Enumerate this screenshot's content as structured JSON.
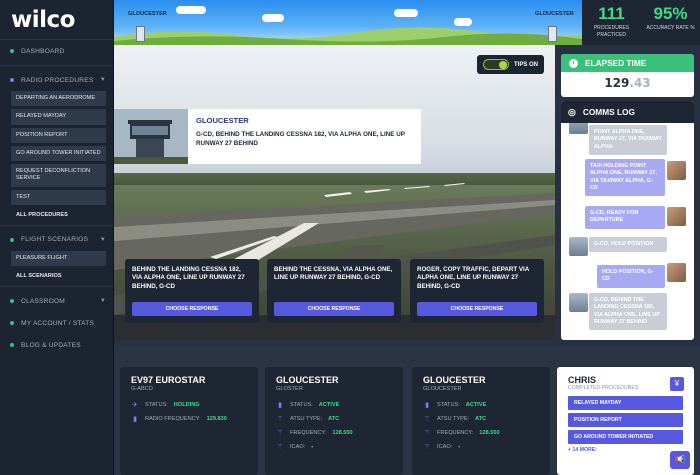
{
  "app": {
    "logo": "wilco"
  },
  "sidebar": {
    "dashboard": "Dashboard",
    "radio_procedures": "Radio Procedures",
    "radio_items": [
      "Departing an Aerodrome",
      "Relayed Mayday",
      "Position Report",
      "Go Around Tower Initiated",
      "Request Deconfliction Service",
      "Test"
    ],
    "all_procedures": "All Procedures",
    "flight_scenarios": "Flight Scenarios",
    "scenario_items": [
      "Pleasure Flight"
    ],
    "all_scenarios": "All Scenarios",
    "classroom": "Classroom",
    "my_account": "My Account / Stats",
    "blog": "Blog & Updates"
  },
  "topbar": {
    "origin": "Gloucester",
    "destination": "Gloucester"
  },
  "stats": {
    "procedures_value": "111",
    "procedures_label": "Procedures Practiced",
    "accuracy_value": "95%",
    "accuracy_label": "Accuracy Rate %"
  },
  "tips": {
    "label": "Tips On"
  },
  "atc": {
    "name": "Gloucester",
    "message": "G-CD, behind the landing Cessna 182, via Alpha One, line up runway 27 behind"
  },
  "responses": [
    {
      "text": "Behind the landing Cessna 182, via Alpha One, line up runway 27 behind, G-CD",
      "button": "Choose Response"
    },
    {
      "text": "Behind the Cessna, via Alpha One, line up runway 27 behind, G-CD",
      "button": "Choose Response"
    },
    {
      "text": "Roger, copy traffic, depart via Alpha One, line up runway 27 behind, G-CD",
      "button": "Choose Response"
    }
  ],
  "elapsed": {
    "label": "Elapsed Time",
    "main": "129",
    "fraction": ".43"
  },
  "comms": {
    "label": "Comms Log",
    "messages": [
      {
        "side": "left",
        "text": "Point Alpha One, runway 27, via taxiway Alpha"
      },
      {
        "side": "right",
        "text": "Taxi holding point Alpha One, runway 27, via taxiway Alpha, G-CD"
      },
      {
        "side": "right",
        "text": "G-CD, ready for departure"
      },
      {
        "side": "left",
        "text": "G-CD, hold position"
      },
      {
        "side": "right",
        "text": "Hold position, G-CD"
      },
      {
        "side": "left",
        "text": "G-CD, behind the landing Cessna 182, via Alpha One, line up runway 27 behind"
      }
    ]
  },
  "cards": [
    {
      "title": "EV97 Eurostar",
      "sub": "G-ABCD",
      "rows": [
        {
          "label": "Status:",
          "value": "Holding"
        },
        {
          "label": "Radio Frequency:",
          "value": "129.830"
        }
      ]
    },
    {
      "title": "Gloucester",
      "sub": "Gloster",
      "rows": [
        {
          "label": "Status:",
          "value": "Active"
        },
        {
          "label": "ATSU Type:",
          "value": "ATC"
        },
        {
          "label": "Frequency:",
          "value": "128.550"
        },
        {
          "label": "ICAO:",
          "value": "-"
        }
      ]
    },
    {
      "title": "Gloucester",
      "sub": "Gloucester",
      "rows": [
        {
          "label": "Status:",
          "value": "Active"
        },
        {
          "label": "ATSU Type:",
          "value": "ATC"
        },
        {
          "label": "Frequency:",
          "value": "128.550"
        },
        {
          "label": "ICAO:",
          "value": "-"
        }
      ]
    }
  ],
  "chris": {
    "name": "Chris",
    "sub": "Completed Procedures",
    "items": [
      "Relayed Mayday",
      "Position Report",
      "Go Around Tower Initiated"
    ],
    "more": "+ 14 more:"
  },
  "colors": {
    "accent": "#5659e0",
    "success": "#3bbf7a",
    "panel": "#1e2633"
  }
}
